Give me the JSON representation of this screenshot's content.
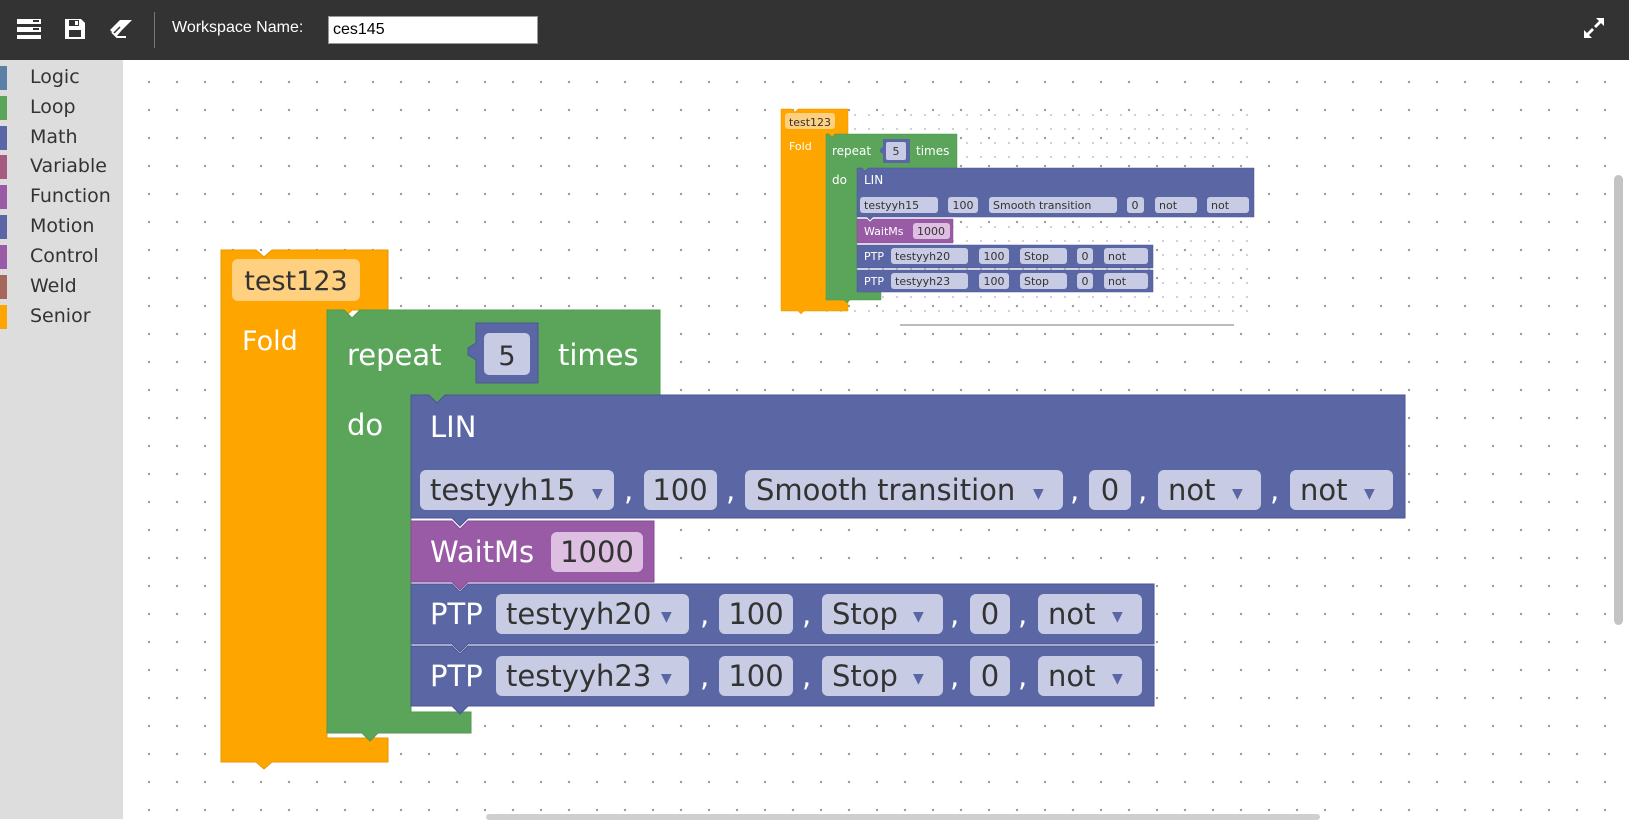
{
  "toolbar": {
    "workspace_label": "Workspace Name:",
    "workspace_value": "ces145"
  },
  "categories": [
    {
      "label": "Logic",
      "color": "#5b80a5"
    },
    {
      "label": "Loop",
      "color": "#5ba55b"
    },
    {
      "label": "Math",
      "color": "#5b67a5"
    },
    {
      "label": "Variable",
      "color": "#a55b80"
    },
    {
      "label": "Function",
      "color": "#995ba5"
    },
    {
      "label": "Motion",
      "color": "#5b67a5"
    },
    {
      "label": "Control",
      "color": "#995ba5"
    },
    {
      "label": "Weld",
      "color": "#a5675b"
    },
    {
      "label": "Senior",
      "color": "#ffa500"
    }
  ],
  "program": {
    "name": "test123",
    "fold_label": "Fold",
    "repeat_label": "repeat",
    "repeat_count": "5",
    "times_label": "times",
    "do_label": "do",
    "lin": {
      "label": "LIN",
      "point": "testyyh15",
      "speed": "100",
      "transition": "Smooth transition",
      "value": "0",
      "opt1": "not",
      "opt2": "not"
    },
    "wait": {
      "label": "WaitMs",
      "value": "1000"
    },
    "ptp1": {
      "label": "PTP",
      "point": "testyyh20",
      "speed": "100",
      "mode": "Stop",
      "value": "0",
      "opt": "not"
    },
    "ptp2": {
      "label": "PTP",
      "point": "testyyh23",
      "speed": "100",
      "mode": "Stop",
      "value": "0",
      "opt": "not"
    },
    "comma": ","
  },
  "colors": {
    "senior": "#ffa500",
    "loop": "#5ba55b",
    "motion": "#5b67a5",
    "function": "#995ba5",
    "toolbar": "#333333"
  }
}
